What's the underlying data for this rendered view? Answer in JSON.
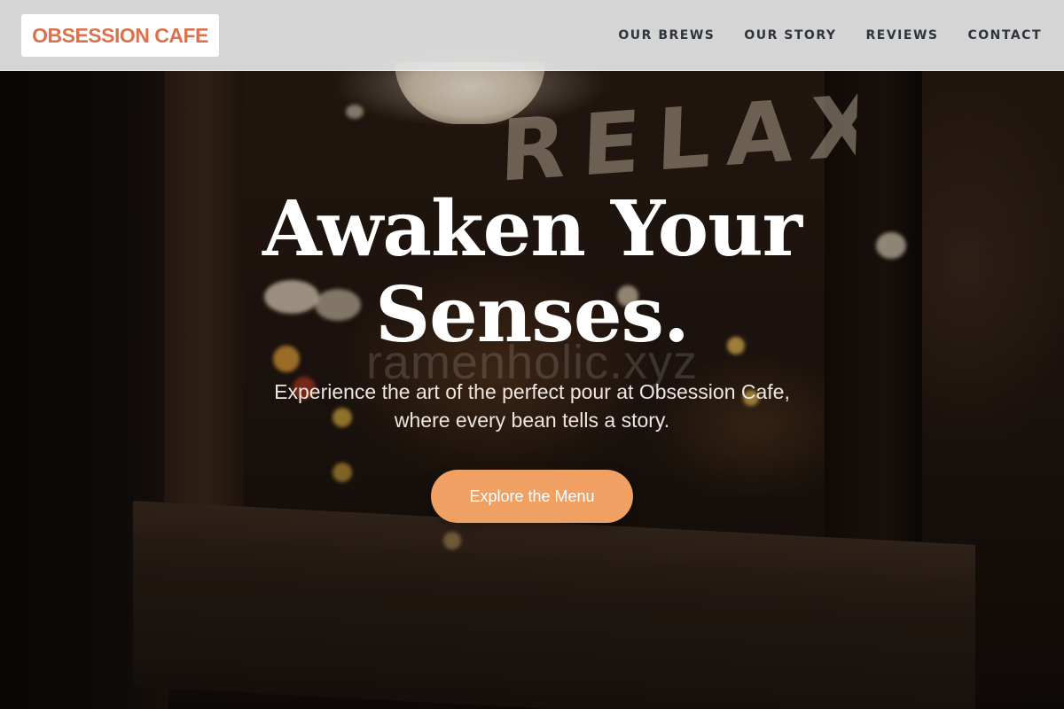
{
  "brand": {
    "name": "OBSESSION CAFE",
    "color": "#d9734e"
  },
  "nav": {
    "items": [
      {
        "label": "OUR BREWS"
      },
      {
        "label": "OUR STORY"
      },
      {
        "label": "REVIEWS"
      },
      {
        "label": "CONTACT"
      }
    ]
  },
  "hero": {
    "sign_text": "RELAX",
    "title_line1": "Awaken Your",
    "title_line2": "Senses.",
    "watermark": "ramenholic.xyz",
    "subtitle_line1": "Experience the art of the perfect pour at Obsession Cafe,",
    "subtitle_line2": "where every bean tells a story.",
    "cta_label": "Explore the Menu",
    "cta_color": "#f0a063"
  }
}
